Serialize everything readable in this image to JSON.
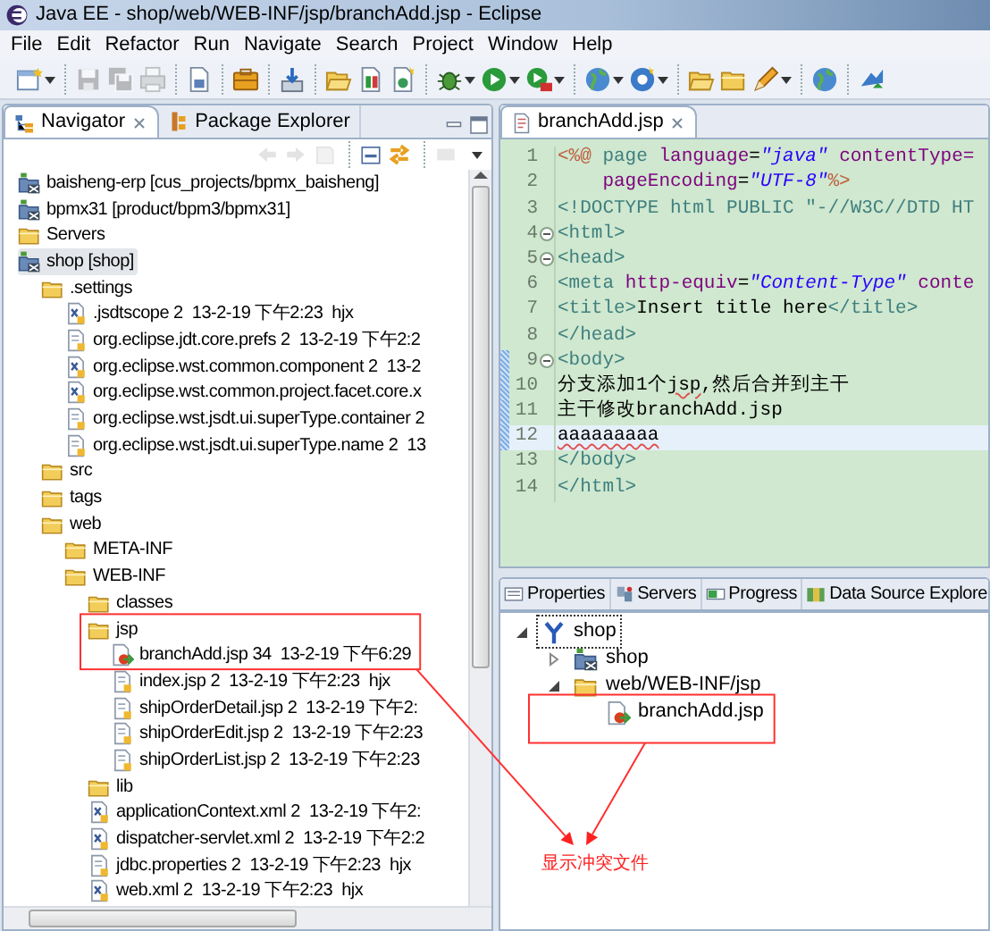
{
  "window": {
    "title": "Java EE - shop/web/WEB-INF/jsp/branchAdd.jsp - Eclipse"
  },
  "menu": [
    "File",
    "Edit",
    "Refactor",
    "Run",
    "Navigate",
    "Search",
    "Project",
    "Window",
    "Help"
  ],
  "toolbar": [
    [
      {
        "disabled": false,
        "dropdown": true
      }
    ],
    [
      {
        "disabled": true,
        "dropdown": false
      },
      {
        "disabled": true,
        "dropdown": false
      },
      {
        "disabled": true,
        "dropdown": false
      }
    ],
    [
      {
        "disabled": false,
        "dropdown": false
      }
    ],
    [
      {
        "disabled": false,
        "dropdown": false
      }
    ],
    [
      {
        "disabled": false,
        "dropdown": false
      }
    ],
    [
      {
        "disabled": false,
        "dropdown": false
      },
      {
        "disabled": false,
        "dropdown": false
      },
      {
        "disabled": false,
        "dropdown": false
      }
    ],
    [
      {
        "disabled": false,
        "dropdown": true
      },
      {
        "disabled": false,
        "dropdown": true
      },
      {
        "disabled": false,
        "dropdown": true
      }
    ],
    [
      {
        "disabled": false,
        "dropdown": true
      },
      {
        "disabled": false,
        "dropdown": true
      }
    ],
    [
      {
        "disabled": false,
        "dropdown": false
      },
      {
        "disabled": false,
        "dropdown": false
      },
      {
        "disabled": false,
        "dropdown": true
      }
    ],
    [
      {
        "disabled": false,
        "dropdown": false
      }
    ],
    [
      {
        "disabled": false,
        "dropdown": false
      }
    ]
  ],
  "navigator": {
    "tabs": [
      {
        "label": "Navigator",
        "selected": true
      },
      {
        "label": "Package Explorer",
        "selected": false
      }
    ],
    "toolbar": [
      [
        {
          "disabled": true
        },
        {
          "disabled": true
        },
        {
          "disabled": true
        }
      ],
      [
        {
          "disabled": false
        },
        {
          "disabled": false
        }
      ],
      [
        {
          "disabled": true
        }
      ]
    ],
    "tree": [
      {
        "label": "baisheng-erp [cus_projects/bpmx_baisheng]",
        "kind": "project",
        "selected": false
      },
      {
        "label": "bpmx31 [product/bpm3/bpmx31]",
        "kind": "project",
        "selected": false
      },
      {
        "label": "Servers",
        "kind": "folder",
        "selected": false
      },
      {
        "label": "shop [shop]",
        "kind": "project",
        "selected": true,
        "children": [
          {
            "label": ".settings",
            "kind": "folder",
            "selected": false,
            "children": [
              {
                "label": ".jsdtscope 2  13-2-19 下午2:23  hjx",
                "kind": "xml",
                "selected": false
              },
              {
                "label": "org.eclipse.jdt.core.prefs 2  13-2-19 下午2:2",
                "kind": "file",
                "selected": false
              },
              {
                "label": "org.eclipse.wst.common.component 2  13-2",
                "kind": "xml",
                "selected": false
              },
              {
                "label": "org.eclipse.wst.common.project.facet.core.x",
                "kind": "xml",
                "selected": false
              },
              {
                "label": "org.eclipse.wst.jsdt.ui.superType.container 2",
                "kind": "file",
                "selected": false
              },
              {
                "label": "org.eclipse.wst.jsdt.ui.superType.name 2  13",
                "kind": "file",
                "selected": false
              }
            ]
          },
          {
            "label": "src",
            "kind": "folder",
            "selected": false
          },
          {
            "label": "tags",
            "kind": "folder",
            "selected": false
          },
          {
            "label": "web",
            "kind": "folder",
            "selected": false,
            "children": [
              {
                "label": "META-INF",
                "kind": "folder",
                "selected": false
              },
              {
                "label": "WEB-INF",
                "kind": "folder",
                "selected": false,
                "children": [
                  {
                    "label": "classes",
                    "kind": "folder",
                    "selected": false
                  },
                  {
                    "label": "jsp",
                    "kind": "folder",
                    "selected": false,
                    "children": [
                      {
                        "label": "branchAdd.jsp 34  13-2-19 下午6:29",
                        "kind": "conflict",
                        "selected": false
                      },
                      {
                        "label": "index.jsp 2  13-2-19 下午2:23  hjx",
                        "kind": "file",
                        "selected": false
                      },
                      {
                        "label": "shipOrderDetail.jsp 2  13-2-19 下午2:",
                        "kind": "file",
                        "selected": false
                      },
                      {
                        "label": "shipOrderEdit.jsp 2  13-2-19 下午2:23",
                        "kind": "file",
                        "selected": false
                      },
                      {
                        "label": "shipOrderList.jsp 2  13-2-19 下午2:23",
                        "kind": "file",
                        "selected": false
                      }
                    ]
                  },
                  {
                    "label": "lib",
                    "kind": "folder",
                    "selected": false
                  },
                  {
                    "label": "applicationContext.xml 2  13-2-19 下午2:",
                    "kind": "xml",
                    "selected": false
                  },
                  {
                    "label": "dispatcher-servlet.xml 2  13-2-19 下午2:2",
                    "kind": "xml",
                    "selected": false
                  },
                  {
                    "label": "jdbc.properties 2  13-2-19 下午2:23  hjx",
                    "kind": "file",
                    "selected": false
                  },
                  {
                    "label": "web.xml 2  13-2-19 下午2:23  hjx",
                    "kind": "xml",
                    "selected": false
                  }
                ]
              }
            ]
          }
        ]
      }
    ]
  },
  "editor": {
    "tabs": [
      {
        "label": "branchAdd.jsp",
        "selected": true
      }
    ],
    "lines": [
      {
        "number": "1",
        "fold": false,
        "changed": false,
        "current": false,
        "tokens": [
          {
            "kind": "delim",
            "text": "<%@"
          },
          {
            "kind": "tag",
            "text": " page"
          },
          {
            "kind": "attr",
            "text": " language"
          },
          {
            "kind": "text",
            "text": "="
          },
          {
            "kind": "string",
            "text": "\"java\""
          },
          {
            "kind": "attr",
            "text": " contentType="
          }
        ]
      },
      {
        "number": "2",
        "fold": false,
        "changed": false,
        "current": false,
        "tokens": [
          {
            "kind": "attr",
            "text": "    pageEncoding"
          },
          {
            "kind": "text",
            "text": "="
          },
          {
            "kind": "string",
            "text": "\"UTF-8\""
          },
          {
            "kind": "delim",
            "text": "%>"
          }
        ]
      },
      {
        "number": "3",
        "fold": false,
        "changed": false,
        "current": false,
        "tokens": [
          {
            "kind": "doctype",
            "text": "<!DOCTYPE html PUBLIC \"-//W3C//DTD HT"
          }
        ]
      },
      {
        "number": "4",
        "fold": true,
        "changed": false,
        "current": false,
        "tokens": [
          {
            "kind": "tag",
            "text": "<html>"
          }
        ]
      },
      {
        "number": "5",
        "fold": true,
        "changed": false,
        "current": false,
        "tokens": [
          {
            "kind": "tag",
            "text": "<head>"
          }
        ]
      },
      {
        "number": "6",
        "fold": false,
        "changed": false,
        "current": false,
        "tokens": [
          {
            "kind": "tag",
            "text": "<meta"
          },
          {
            "kind": "attr",
            "text": " http-equiv"
          },
          {
            "kind": "text",
            "text": "="
          },
          {
            "kind": "string",
            "text": "\"Content-Type\""
          },
          {
            "kind": "attr",
            "text": " conte"
          }
        ]
      },
      {
        "number": "7",
        "fold": false,
        "changed": false,
        "current": false,
        "tokens": [
          {
            "kind": "tag",
            "text": "<title>"
          },
          {
            "kind": "text",
            "text": "Insert title here"
          },
          {
            "kind": "tag",
            "text": "</title>"
          }
        ]
      },
      {
        "number": "8",
        "fold": false,
        "changed": false,
        "current": false,
        "tokens": [
          {
            "kind": "tag",
            "text": "</head>"
          }
        ]
      },
      {
        "number": "9",
        "fold": true,
        "changed": true,
        "current": false,
        "tokens": [
          {
            "kind": "tag",
            "text": "<body>"
          }
        ]
      },
      {
        "number": "10",
        "fold": false,
        "changed": true,
        "current": false,
        "tokens": [
          {
            "kind": "text",
            "text": "分支添加1个"
          },
          {
            "kind": "misspelled",
            "text": "jsp"
          },
          {
            "kind": "text",
            "text": ",然后合并到主干"
          }
        ]
      },
      {
        "number": "11",
        "fold": false,
        "changed": true,
        "current": false,
        "tokens": [
          {
            "kind": "text",
            "text": "主干修改branchAdd.jsp"
          }
        ]
      },
      {
        "number": "12",
        "fold": false,
        "changed": true,
        "current": true,
        "tokens": [
          {
            "kind": "misspelled",
            "text": "aaaaaaaaa"
          }
        ]
      },
      {
        "number": "13",
        "fold": false,
        "changed": false,
        "current": false,
        "tokens": [
          {
            "kind": "tag",
            "text": "</body>"
          }
        ]
      },
      {
        "number": "14",
        "fold": false,
        "changed": false,
        "current": false,
        "tokens": [
          {
            "kind": "tag",
            "text": "</html>"
          }
        ]
      }
    ]
  },
  "bottom_panel": {
    "tabs": [
      {
        "label": "Properties",
        "selected": false
      },
      {
        "label": "Servers",
        "selected": false
      },
      {
        "label": "Progress",
        "selected": false
      },
      {
        "label": "Data Source Explore",
        "selected": false
      }
    ],
    "tree": [
      {
        "label": "shop",
        "kind": "repository",
        "focused": true,
        "expanded": true,
        "children": [
          {
            "label": "shop",
            "kind": "project",
            "focused": false,
            "expanded": false
          },
          {
            "label": "web/WEB-INF/jsp",
            "kind": "folder",
            "focused": false,
            "expanded": true,
            "children": [
              {
                "label": "branchAdd.jsp",
                "kind": "conflict",
                "focused": false
              }
            ]
          }
        ]
      }
    ]
  },
  "annotations": [
    {
      "kind": "box"
    },
    {
      "kind": "box"
    },
    {
      "kind": "arrow"
    },
    {
      "kind": "arrow"
    },
    {
      "kind": "label",
      "text": "显示冲突文件"
    }
  ]
}
